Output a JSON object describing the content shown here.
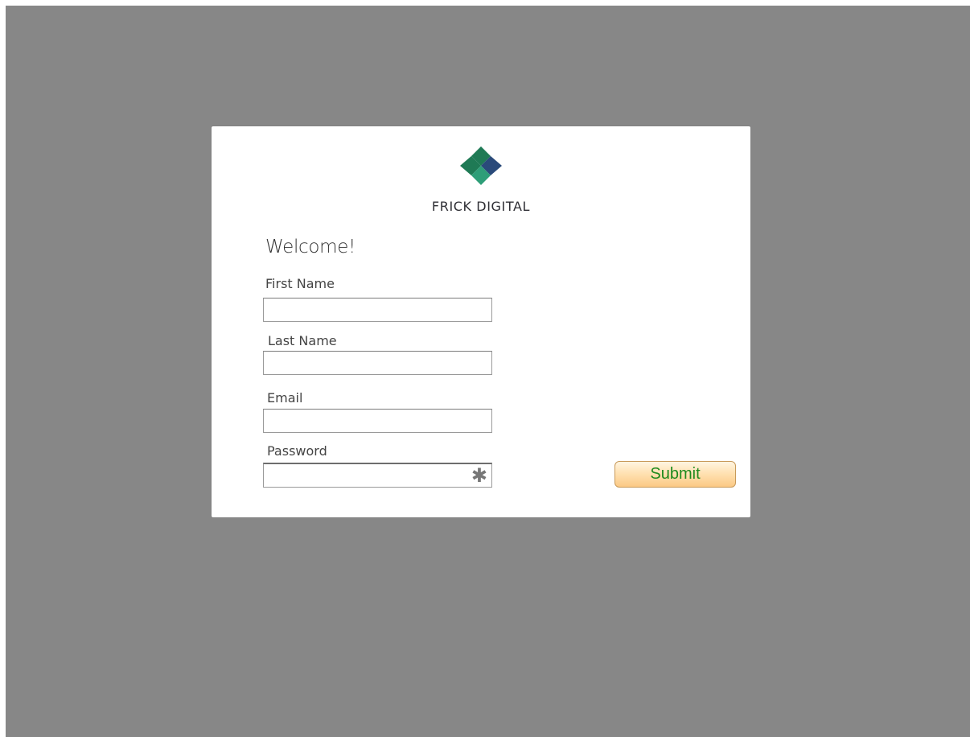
{
  "brand": {
    "name": "FRICK DIGITAL",
    "logo_icon": "diamond-logo-icon",
    "logo_colors": [
      "#1f7a55",
      "#2a4a7a",
      "#2e9e78"
    ]
  },
  "form": {
    "heading": "Welcome!",
    "first_name_label": "First Name",
    "first_name_value": "",
    "last_name_label": "Last Name",
    "last_name_value": "",
    "email_label": "Email",
    "email_value": "",
    "password_label": "Password",
    "password_value": "",
    "password_indicator": "✱",
    "submit_label": "Submit"
  },
  "colors": {
    "backdrop": "#878787",
    "card": "#ffffff",
    "submit_text": "#1d8a1d",
    "submit_fill": "#ffe2b3"
  }
}
